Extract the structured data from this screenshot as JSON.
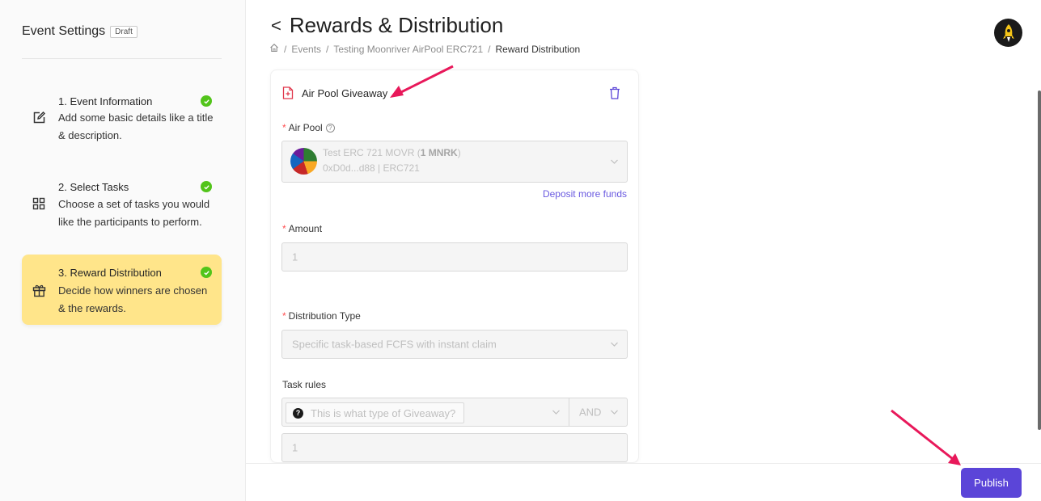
{
  "sidebar": {
    "title": "Event Settings",
    "badge": "Draft",
    "steps": [
      {
        "title": "1. Event Information",
        "desc": "Add some basic details like a title & description.",
        "icon": "edit-icon",
        "done": true
      },
      {
        "title": "2. Select Tasks",
        "desc": "Choose a set of tasks you would like the participants to perform.",
        "icon": "grid-icon",
        "done": true
      },
      {
        "title": "3. Reward Distribution",
        "desc": "Decide how winners are chosen & the rewards.",
        "icon": "gift-icon",
        "done": true,
        "active": true
      }
    ]
  },
  "header": {
    "title": "Rewards & Distribution",
    "breadcrumb": [
      "Events",
      "Testing Moonriver AirPool ERC721",
      "Reward Distribution"
    ]
  },
  "card": {
    "title": "Air Pool Giveaway",
    "air_pool_label": "Air Pool",
    "pool": {
      "name": "Test ERC 721 MOVR (",
      "amount": "1 MNRK",
      "close": ")",
      "address": "0xD0d...d88  |  ERC721"
    },
    "deposit_link": "Deposit more funds",
    "amount_label": "Amount",
    "amount_value": "1",
    "distribution_label": "Distribution Type",
    "distribution_value": "Specific task-based FCFS with instant claim",
    "task_rules_label": "Task rules",
    "task_rule_placeholder": "This is what type of Giveaway?",
    "operator": "AND",
    "rule_value": "1"
  },
  "footer": {
    "publish_label": "Publish"
  },
  "colors": {
    "accent": "#5b45d8",
    "active_step": "#ffe58a",
    "success": "#52c41a",
    "required": "#ff4d4f",
    "annotation": "#e8185a"
  }
}
